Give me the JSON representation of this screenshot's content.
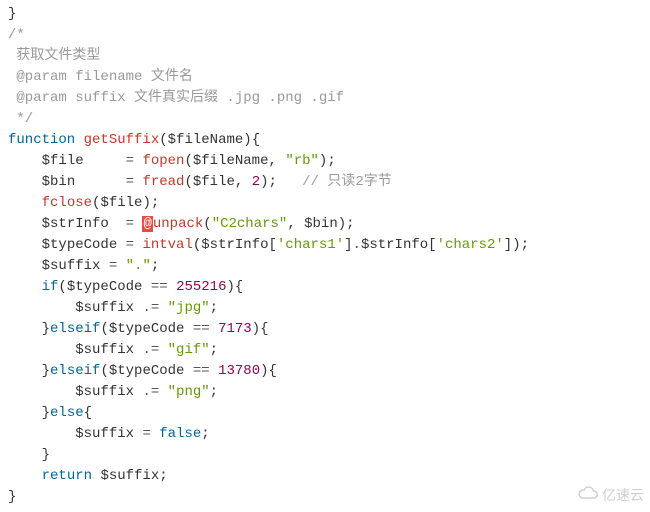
{
  "code": {
    "l0": "}",
    "l1": "/*",
    "l2": " 获取文件类型",
    "l3": " @param filename 文件名",
    "l4": " @param suffix 文件真实后缀 .jpg .png .gif",
    "l5": " */",
    "kw_function": "function",
    "fn_name": "getSuffix",
    "var_fileName": "$fileName",
    "var_file": "$file",
    "var_bin": "$bin",
    "var_strInfo": "$strInfo",
    "var_typeCode": "$typeCode",
    "var_suffix": "$suffix",
    "fn_fopen": "fopen",
    "fn_fread": "fread",
    "fn_fclose": "fclose",
    "fn_unpack": "unpack",
    "fn_intval": "intval",
    "str_rb": "\"rb\"",
    "num_2": "2",
    "comment_2bytes": "// 只读2字节",
    "str_c2chars": "\"C2chars\"",
    "str_chars1": "'chars1'",
    "str_chars2": "'chars2'",
    "str_dot": "\".\"",
    "num_255216": "255216",
    "str_jpg": "\"jpg\"",
    "num_7173": "7173",
    "str_gif": "\"gif\"",
    "num_13780": "13780",
    "str_png": "\"png\"",
    "kw_if": "if",
    "kw_elseif": "elseif",
    "kw_else": "else",
    "kw_return": "return",
    "kw_false": "false",
    "err_at": "@",
    "op_eq": "=",
    "op_cmp": "==",
    "op_concat_eq": ".=",
    "op_concat": ".",
    "p_open": "(",
    "p_close": ")",
    "b_open": "{",
    "b_close": "}",
    "sq_open": "[",
    "sq_close": "]",
    "comma": ",",
    "semi": ";"
  },
  "watermark": {
    "text": "亿速云"
  }
}
